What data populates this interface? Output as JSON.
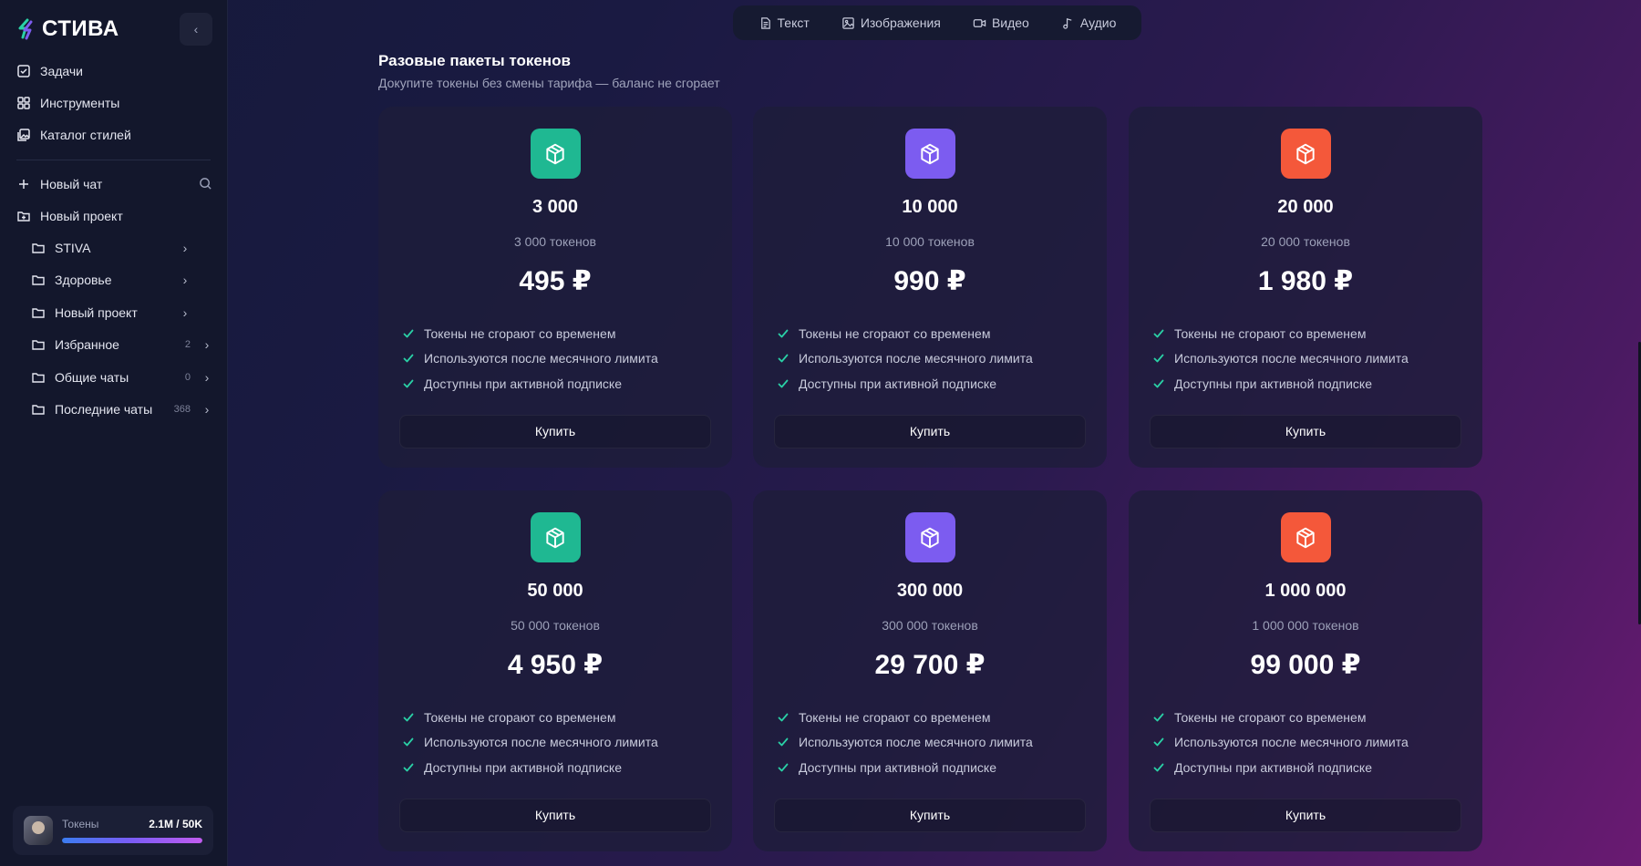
{
  "app": {
    "logo_text": "СТИВА",
    "logo_color_primary": "#6c6ef5",
    "logo_color_secondary": "#2ad0a6"
  },
  "sidebar": {
    "nav": [
      {
        "label": "Задачи",
        "icon": "checkbox-icon"
      },
      {
        "label": "Инструменты",
        "icon": "grid-icon"
      },
      {
        "label": "Каталог стилей",
        "icon": "gallery-icon"
      }
    ],
    "new_chat": {
      "label": "Новый чат",
      "icon": "plus-icon"
    },
    "new_project": {
      "label": "Новый проект",
      "icon": "folder-plus-icon"
    },
    "folders": [
      {
        "label": "STIVA",
        "count": ""
      },
      {
        "label": "Здоровье",
        "count": ""
      },
      {
        "label": "Новый проект",
        "count": ""
      },
      {
        "label": "Избранное",
        "count": "2"
      },
      {
        "label": "Общие чаты",
        "count": "0"
      },
      {
        "label": "Последние чаты",
        "count": "368"
      }
    ],
    "tokens": {
      "label": "Токены",
      "value": "2.1M / 50K",
      "progress": 1.0
    }
  },
  "tabs": [
    {
      "label": "Текст",
      "icon": "document-icon"
    },
    {
      "label": "Изображения",
      "icon": "image-icon"
    },
    {
      "label": "Видео",
      "icon": "video-icon"
    },
    {
      "label": "Аудио",
      "icon": "music-note-icon"
    }
  ],
  "section": {
    "title": "Разовые пакеты токенов",
    "subtitle": "Докупите токены без смены тарифа — баланс не сгорает"
  },
  "packages": [
    {
      "amount": "3 000",
      "tokens": "3 000 токенов",
      "price": "495 ₽",
      "color": "#1fb892",
      "button": "Купить"
    },
    {
      "amount": "10 000",
      "tokens": "10 000 токенов",
      "price": "990 ₽",
      "color": "#7c5cf0",
      "button": "Купить"
    },
    {
      "amount": "20 000",
      "tokens": "20 000 токенов",
      "price": "1 980 ₽",
      "color": "#f4583a",
      "button": "Купить"
    },
    {
      "amount": "50 000",
      "tokens": "50 000 токенов",
      "price": "4 950 ₽",
      "color": "#1fb892",
      "button": "Купить"
    },
    {
      "amount": "300 000",
      "tokens": "300 000 токенов",
      "price": "29 700 ₽",
      "color": "#7c5cf0",
      "button": "Купить"
    },
    {
      "amount": "1 000 000",
      "tokens": "1 000 000 токенов",
      "price": "99 000 ₽",
      "color": "#f4583a",
      "button": "Купить"
    }
  ],
  "features": [
    "Токены не сгорают со временем",
    "Используются после месячного лимита",
    "Доступны при активной подписке"
  ],
  "check_color": "#2ad0a6"
}
